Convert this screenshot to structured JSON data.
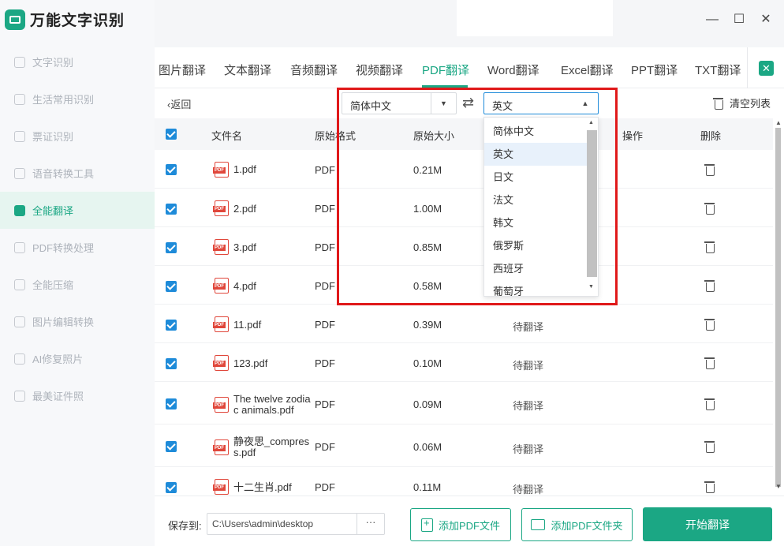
{
  "app": {
    "title": "万能文字识别"
  },
  "window": {
    "minimize": "—",
    "maximize": "☐",
    "close": "✕"
  },
  "sidebar": {
    "items": [
      {
        "label": "文字识别",
        "active": false
      },
      {
        "label": "生活常用识别",
        "active": false
      },
      {
        "label": "票证识别",
        "active": false
      },
      {
        "label": "语音转换工具",
        "active": false
      },
      {
        "label": "全能翻译",
        "active": true
      },
      {
        "label": "PDF转换处理",
        "active": false
      },
      {
        "label": "全能压缩",
        "active": false
      },
      {
        "label": "图片编辑转换",
        "active": false
      },
      {
        "label": "AI修复照片",
        "active": false
      },
      {
        "label": "最美证件照",
        "active": false
      }
    ]
  },
  "tabs": {
    "items": [
      "图片翻译",
      "文本翻译",
      "音频翻译",
      "视频翻译",
      "PDF翻译",
      "Word翻译",
      "Excel翻译",
      "PPT翻译",
      "TXT翻译"
    ],
    "active": "PDF翻译"
  },
  "toolbar": {
    "back": "返回",
    "source_lang": "简体中文",
    "target_lang": "英文",
    "swap_icon": "⇄",
    "clear_list": "清空列表"
  },
  "dropdown": {
    "options": [
      "简体中文",
      "英文",
      "日文",
      "法文",
      "韩文",
      "俄罗斯",
      "西班牙",
      "葡萄牙"
    ],
    "selected": "英文"
  },
  "table": {
    "headers": {
      "name": "文件名",
      "format": "原始格式",
      "size": "原始大小",
      "action": "操作",
      "delete": "删除"
    },
    "rows": [
      {
        "name": "1.pdf",
        "format": "PDF",
        "size": "0.21M",
        "status": ""
      },
      {
        "name": "2.pdf",
        "format": "PDF",
        "size": "1.00M",
        "status": ""
      },
      {
        "name": "3.pdf",
        "format": "PDF",
        "size": "0.85M",
        "status": ""
      },
      {
        "name": "4.pdf",
        "format": "PDF",
        "size": "0.58M",
        "status": ""
      },
      {
        "name": "11.pdf",
        "format": "PDF",
        "size": "0.39M",
        "status": "待翻译"
      },
      {
        "name": "123.pdf",
        "format": "PDF",
        "size": "0.10M",
        "status": "待翻译"
      },
      {
        "name_line1": "The twelve zodia",
        "name_line2": "c animals.pdf",
        "format": "PDF",
        "size": "0.09M",
        "status": "待翻译"
      },
      {
        "name_line1": "静夜思_compres",
        "name_line2": "s.pdf",
        "format": "PDF",
        "size": "0.06M",
        "status": "待翻译"
      },
      {
        "name": "十二生肖.pdf",
        "format": "PDF",
        "size": "0.11M",
        "status": "待翻译"
      }
    ]
  },
  "bottom": {
    "save_label": "保存到:",
    "save_path": "C:\\Users\\admin\\desktop",
    "browse": "···",
    "add_file": "添加PDF文件",
    "add_folder": "添加PDF文件夹",
    "start": "开始翻译"
  },
  "pdf_badge": "PDF",
  "colors": {
    "accent": "#1ba784",
    "checkbox": "#1e8bd9",
    "highlight": "#e0191a"
  }
}
